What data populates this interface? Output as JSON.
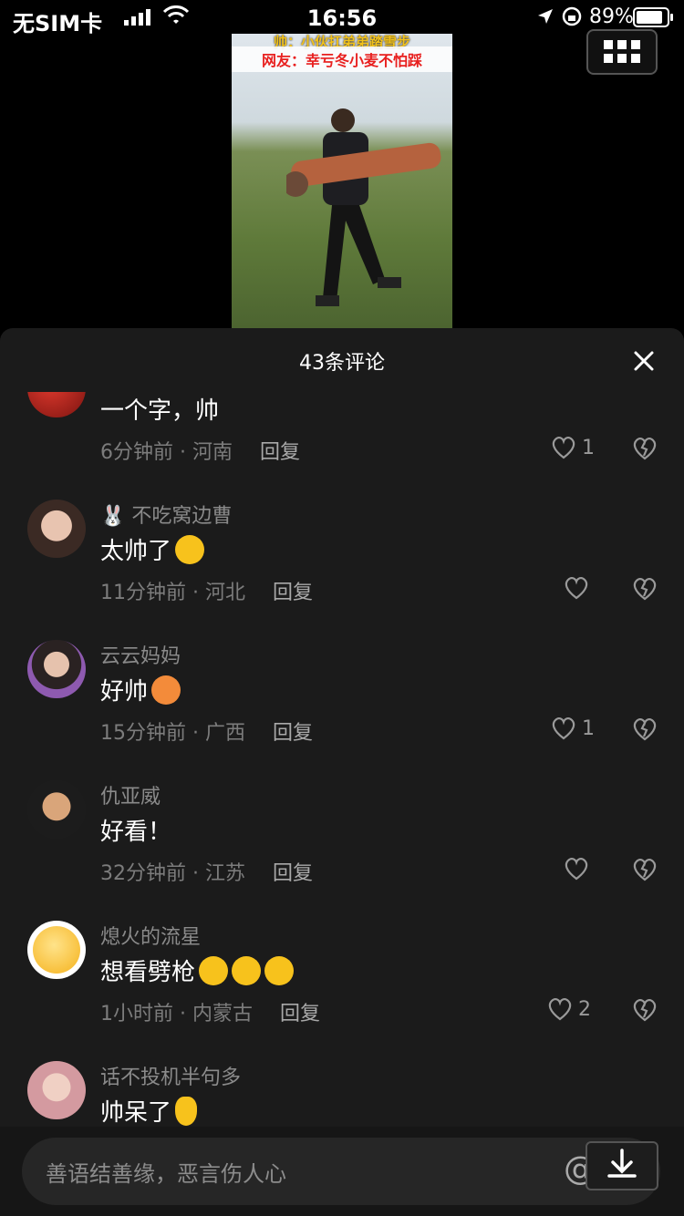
{
  "status": {
    "carrier": "无SIM卡",
    "time": "16:56",
    "battery_pct": "89%",
    "battery_level": 0.89
  },
  "video": {
    "caption_top": "帅：小伙扛弟弟踏雪步",
    "caption_main": "网友：幸亏冬小麦不怕踩"
  },
  "panel": {
    "title": "43条评论"
  },
  "comments": [
    {
      "user": "",
      "text": "一个字，帅",
      "emoji": [],
      "time_loc": "6分钟前 · 河南",
      "reply": "回复",
      "likes": "1"
    },
    {
      "user": "🐰 不吃窝边曹",
      "text": "太帅了",
      "emoji": [
        "laugh"
      ],
      "time_loc": "11分钟前 · 河北",
      "reply": "回复",
      "likes": ""
    },
    {
      "user": "云云妈妈",
      "text": "好帅",
      "emoji": [
        "star-eyes"
      ],
      "time_loc": "15分钟前 · 广西",
      "reply": "回复",
      "likes": "1"
    },
    {
      "user": "仇亚威",
      "text": "好看！",
      "emoji": [],
      "time_loc": "32分钟前 · 江苏",
      "reply": "回复",
      "likes": ""
    },
    {
      "user": "熄火的流星",
      "text": "想看劈枪",
      "emoji": [
        "cry",
        "cry",
        "cry"
      ],
      "time_loc": "1小时前 · 内蒙古",
      "reply": "回复",
      "likes": "2"
    },
    {
      "user": "话不投机半句多",
      "text": "帅呆了",
      "emoji": [
        "heart-hand"
      ],
      "time_loc": "",
      "reply": "",
      "likes": ""
    }
  ],
  "input": {
    "placeholder": "善语结善缘，恶言伤人心",
    "at": "@"
  },
  "colors": {
    "panel_bg": "#1b1b1b",
    "meta_text": "#7c7c7c"
  }
}
